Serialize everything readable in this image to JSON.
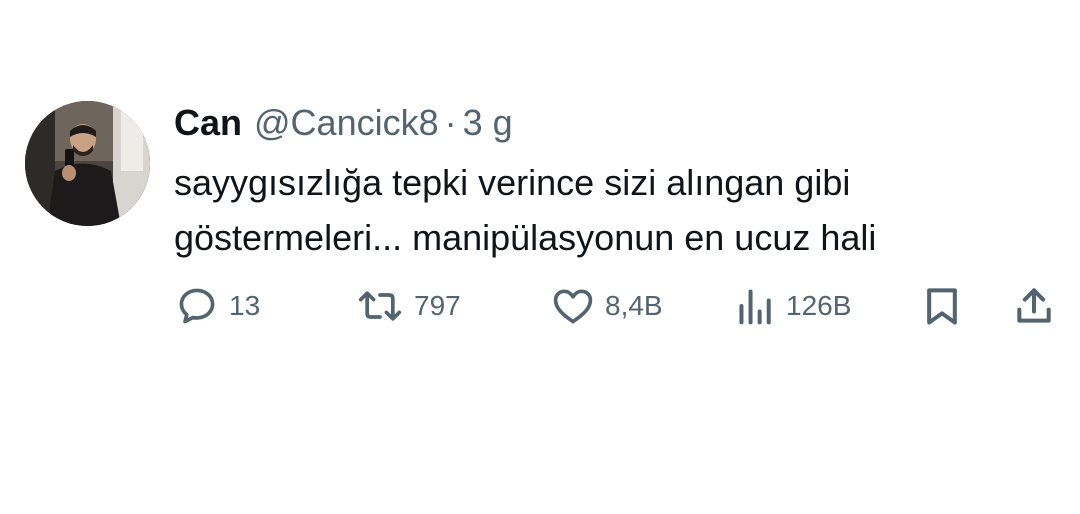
{
  "tweet": {
    "author_name": "Can",
    "handle": "@Cancick8",
    "separator": "·",
    "time": "3 g",
    "text_lines": [
      "sayygısızlığa tepki verince sizi alıngan gibi",
      "göstermeleri... manipülasyonun en ucuz hali"
    ]
  },
  "actions": {
    "reply": {
      "icon": "reply-bubble-icon",
      "count": "13"
    },
    "retweet": {
      "icon": "retweet-icon",
      "count": "797"
    },
    "like": {
      "icon": "heart-icon",
      "count": "8,4B"
    },
    "views": {
      "icon": "views-chart-icon",
      "count": "126B"
    },
    "bookmark": {
      "icon": "bookmark-icon"
    },
    "share": {
      "icon": "share-upload-icon"
    }
  },
  "colors": {
    "primary_text": "#0f1419",
    "secondary_text": "#536471",
    "background": "#ffffff"
  }
}
